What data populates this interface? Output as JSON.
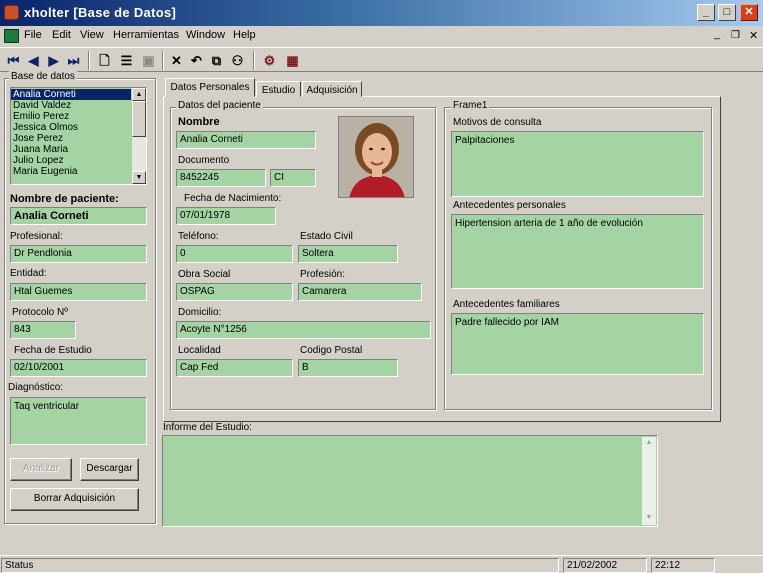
{
  "window": {
    "title": "xholter  [Base de Datos]"
  },
  "menu": [
    "File",
    "Edit",
    "View",
    "Herramientas",
    "Window",
    "Help"
  ],
  "toolbar": {
    "first": "first-record-icon",
    "prev": "prev-record-icon",
    "next": "next-record-icon",
    "last": "last-record-icon",
    "new": "new-document-icon",
    "list": "list-icon",
    "save": "save-icon",
    "delete": "delete-icon",
    "undo": "undo-icon",
    "copy": "copy-icon",
    "find": "binoculars-icon",
    "tool1": "tool-icon",
    "tool2": "tool2-icon"
  },
  "left": {
    "db_legend": "Base de datos",
    "patients": [
      "Analia Corneti",
      "David Valdez",
      "Emilio Perez",
      "Jessica Olmos",
      "Jose Perez",
      "Juana Maria",
      "Julio Lopez",
      "Maria Eugenia"
    ],
    "selected_index": 0,
    "nombre_label": "Nombre de paciente:",
    "nombre_value": "Analia Corneti",
    "profesional_label": "Profesional:",
    "profesional_value": "Dr Pendlonia",
    "entidad_label": "Entidad:",
    "entidad_value": "Htal Guemes",
    "protocolo_label": "Protocolo Nº",
    "protocolo_value": "843",
    "fecha_estudio_label": "Fecha de Estudio",
    "fecha_estudio_value": "02/10/2001",
    "diagnostico_label": "Diagnóstico:",
    "diagnostico_value": "Taq ventricular",
    "analizar": "Analizar",
    "descargar": "Descargar",
    "borrar": "Borrar Adquisición"
  },
  "tabs": [
    "Datos Personales",
    "Estudio",
    "Adquisición"
  ],
  "paciente": {
    "legend": "Datos del paciente",
    "nombre_label": "Nombre",
    "nombre_value": "Analia Corneti",
    "documento_label": "Documento",
    "documento_value": "8452245",
    "documento_tipo": "CI",
    "nacimiento_label": "Fecha de Nacimiento:",
    "nacimiento_value": "07/01/1978",
    "telefono_label": "Teléfono:",
    "telefono_value": "0",
    "estado_label": "Estado Civil",
    "estado_value": "Soltera",
    "obra_label": "Obra Social",
    "obra_value": "OSPAG",
    "profesion_label": "Profesión:",
    "profesion_value": "Camarera",
    "domicilio_label": "Domicilio:",
    "domicilio_value": "Acoyte N°1256",
    "localidad_label": "Localidad",
    "localidad_value": "Cap Fed",
    "cp_label": "Codigo Postal",
    "cp_value": "B"
  },
  "frame1": {
    "legend": "Frame1",
    "motivos_label": "Motivos de consulta",
    "motivos_value": "Palpitaciones",
    "personales_label": "Antecedentes personales",
    "personales_value": "Hipertension arteria de 1 año de evolución",
    "familiares_label": "Antecedentes familiares",
    "familiares_value": "Padre fallecido por IAM"
  },
  "informe": {
    "label": "Informe del Estudio:",
    "value": ""
  },
  "status": {
    "text": "Status",
    "date": "21/02/2002",
    "time": "22:12"
  }
}
